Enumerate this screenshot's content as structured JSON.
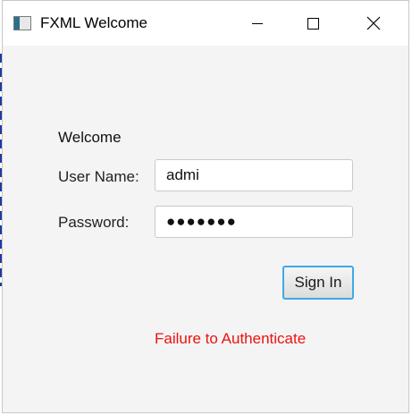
{
  "window": {
    "title": "FXML Welcome"
  },
  "form": {
    "heading": "Welcome",
    "username_label": "User Name:",
    "username_value": "admi",
    "password_label": "Password:",
    "password_masked": "●●●●●●●",
    "signin_label": "Sign In",
    "status_message": "Failure to Authenticate",
    "status_color": "#ee1111"
  },
  "icons": {
    "app": "java-app-icon",
    "minimize": "minimize-icon",
    "maximize": "maximize-icon",
    "close": "close-icon"
  },
  "colors": {
    "focus_ring": "#3fa9e8",
    "window_bg": "#f4f4f4"
  }
}
